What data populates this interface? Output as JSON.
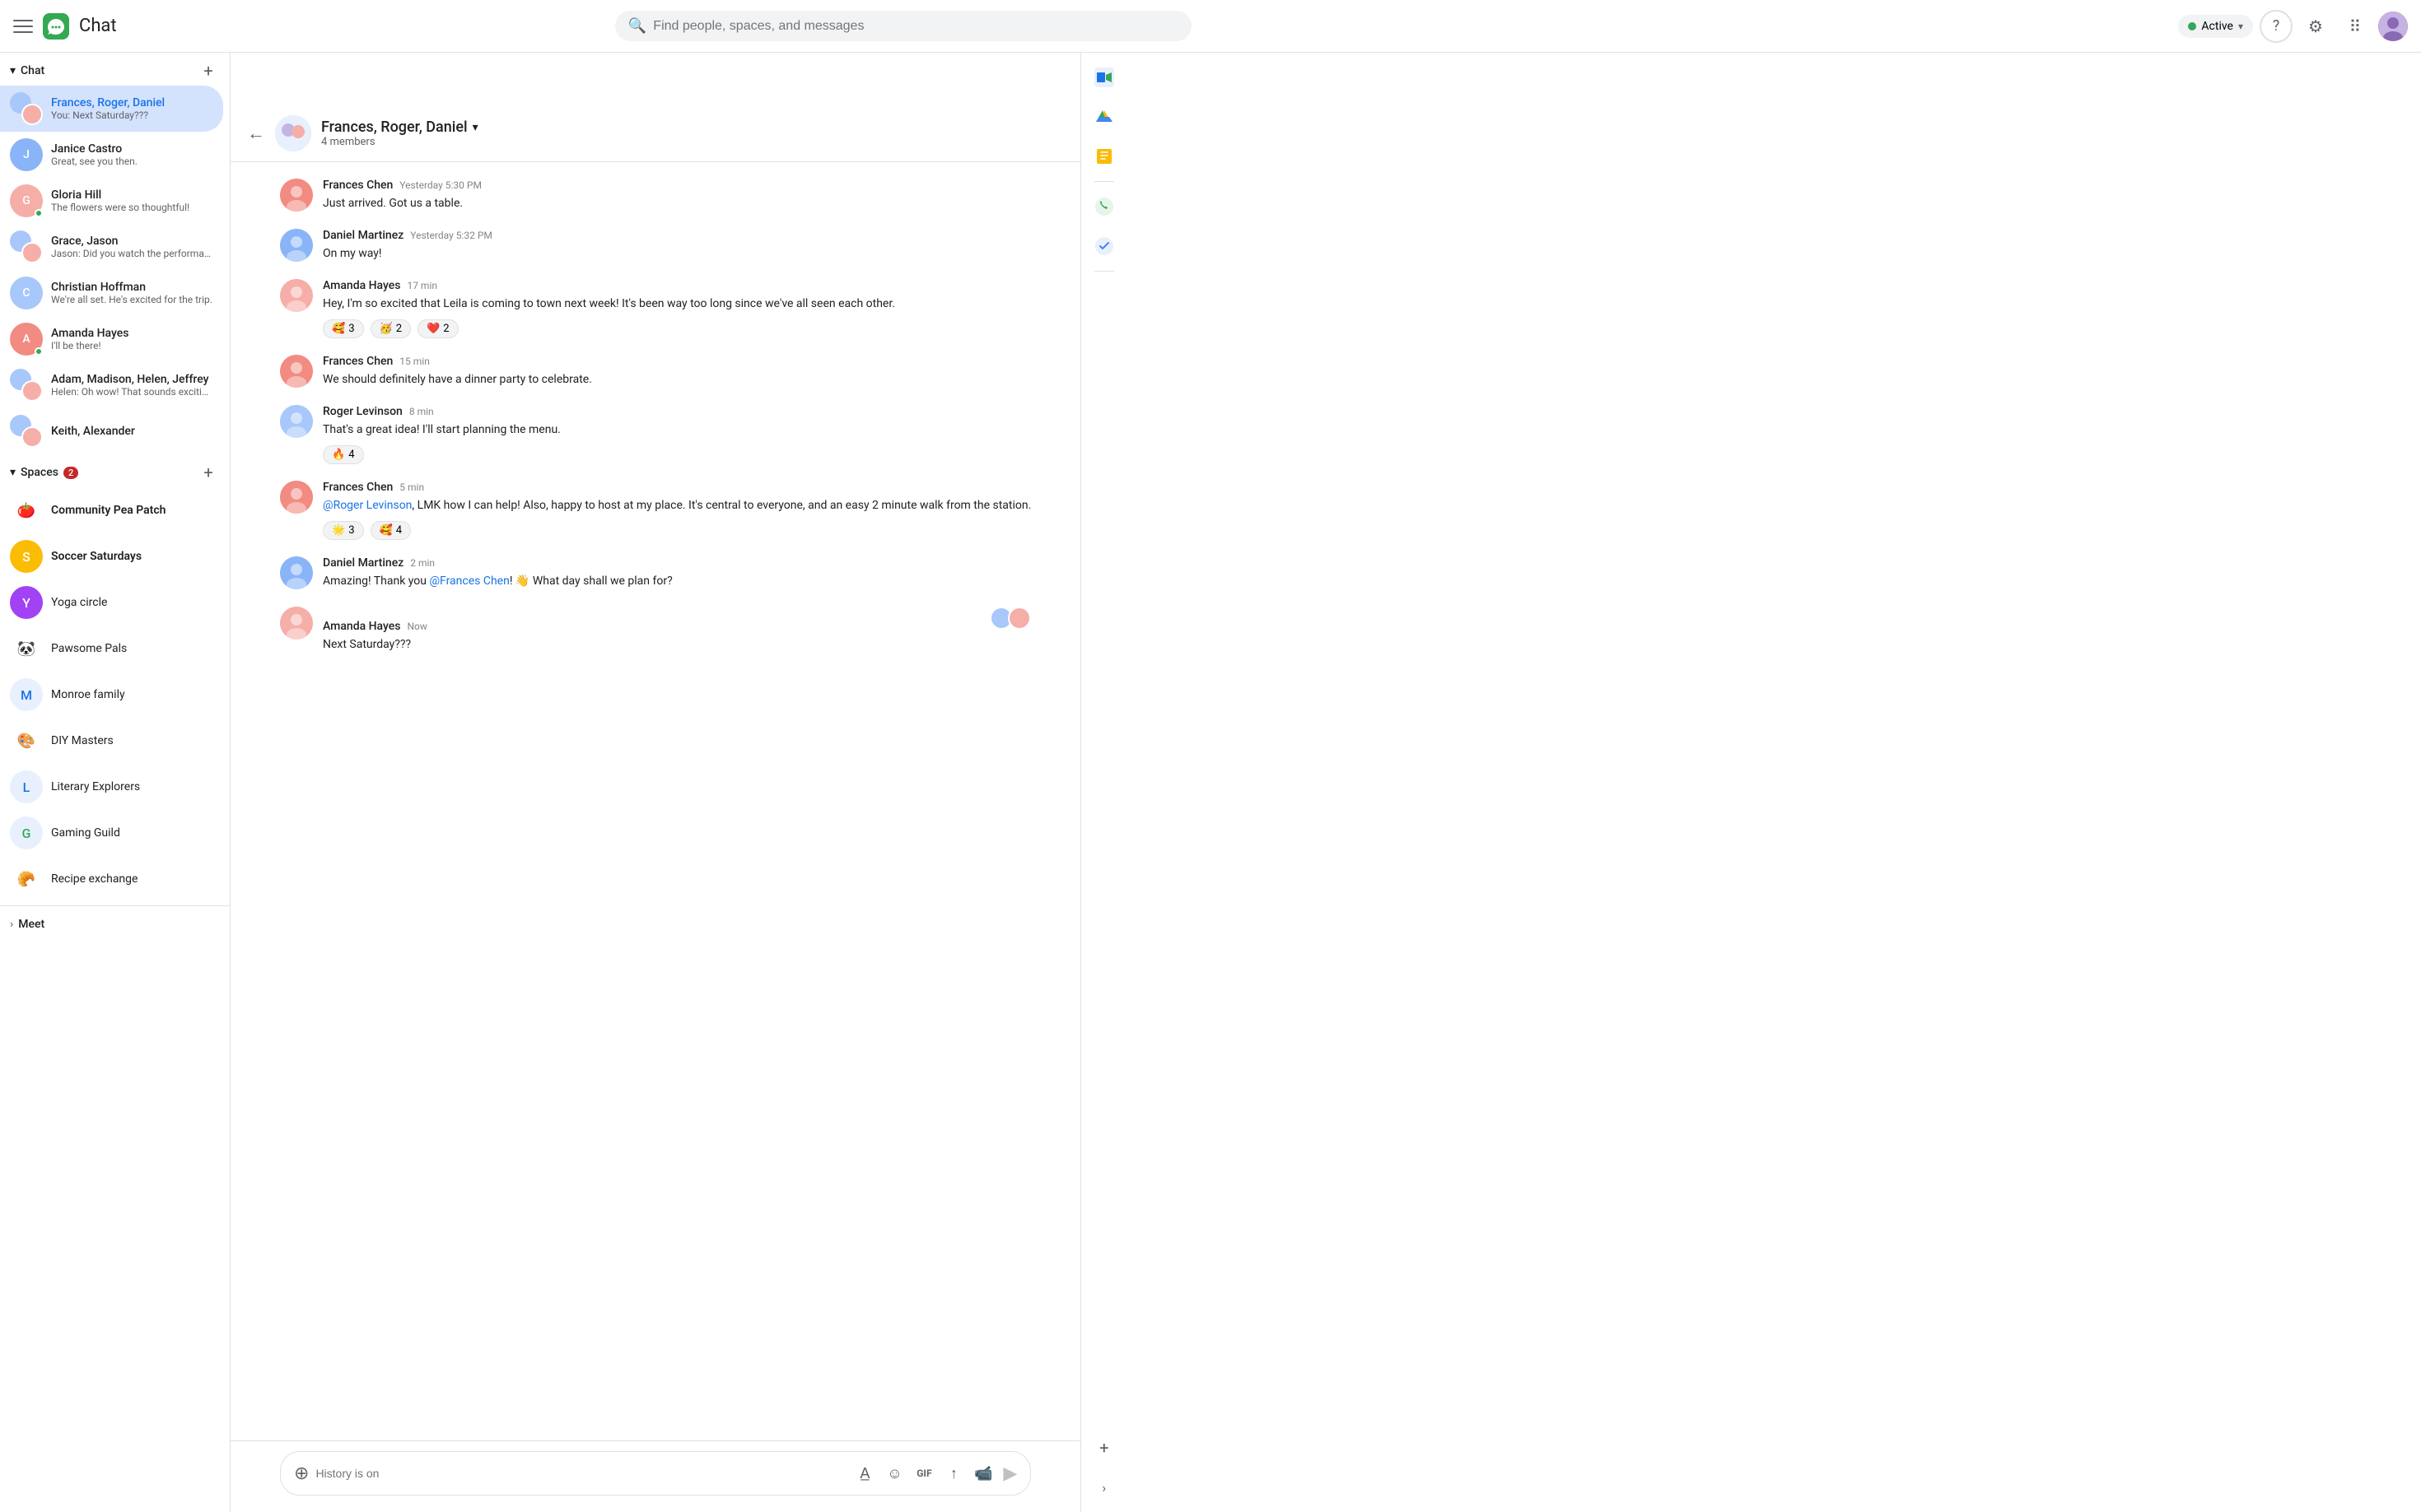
{
  "app": {
    "title": "Chat",
    "logo_color": "#34a853"
  },
  "topbar": {
    "search_placeholder": "Find people, spaces, and messages",
    "active_label": "Active",
    "active_color": "#34a853"
  },
  "sidebar": {
    "chat_section": "Chat",
    "spaces_section": "Spaces",
    "spaces_badge": "2",
    "meet_section": "Meet",
    "add_label": "+",
    "chats": [
      {
        "id": "frances-roger-daniel",
        "name": "Frances, Roger, Daniel",
        "preview": "You: Next Saturday???",
        "active": true,
        "avatar_type": "group"
      },
      {
        "id": "janice-castro",
        "name": "Janice Castro",
        "preview": "Great, see you then.",
        "active": false,
        "avatar_type": "single",
        "color": "#8ab4f8"
      },
      {
        "id": "gloria-hill",
        "name": "Gloria Hill",
        "preview": "The flowers were so thoughtful!",
        "active": false,
        "avatar_type": "single",
        "color": "#f6aea9",
        "online": true
      },
      {
        "id": "grace-jason",
        "name": "Grace, Jason",
        "preview": "Jason: Did you watch the performan ...",
        "active": false,
        "avatar_type": "group"
      },
      {
        "id": "christian-hoffman",
        "name": "Christian Hoffman",
        "preview": "We're all set.  He's excited for the trip.",
        "active": false,
        "avatar_type": "single",
        "color": "#a8c7fa"
      },
      {
        "id": "amanda-hayes",
        "name": "Amanda Hayes",
        "preview": "I'll be there!",
        "active": false,
        "avatar_type": "single",
        "color": "#f28b82",
        "online": true
      },
      {
        "id": "adam-madison-helen-jeffrey",
        "name": "Adam, Madison, Helen, Jeffrey",
        "preview": "Helen: Oh wow! That sounds exciting ...",
        "active": false,
        "avatar_type": "group"
      },
      {
        "id": "keith-alexander",
        "name": "Keith, Alexander",
        "preview": "",
        "active": false,
        "avatar_type": "group"
      }
    ],
    "spaces": [
      {
        "id": "community-pea-patch",
        "name": "Community Pea Patch",
        "icon": "🍅",
        "bold": true
      },
      {
        "id": "soccer-saturdays",
        "name": "Soccer Saturdays",
        "icon": "S",
        "bold": true,
        "icon_bg": "#fbbc04",
        "icon_color": "#fff"
      },
      {
        "id": "yoga-circle",
        "name": "Yoga circle",
        "icon": "Y",
        "bold": false,
        "icon_bg": "#a142f4",
        "icon_color": "#fff"
      },
      {
        "id": "pawsome-pals",
        "name": "Pawsome Pals",
        "icon": "🐼",
        "bold": false
      },
      {
        "id": "monroe-family",
        "name": "Monroe family",
        "icon": "M",
        "bold": false,
        "icon_bg": "#e8f0fe",
        "icon_color": "#1a73e8"
      },
      {
        "id": "diy-masters",
        "name": "DIY Masters",
        "icon": "🎨",
        "bold": false
      },
      {
        "id": "literary-explorers",
        "name": "Literary Explorers",
        "icon": "L",
        "bold": false,
        "icon_bg": "#e8f0fe",
        "icon_color": "#1a73e8"
      },
      {
        "id": "gaming-guild",
        "name": "Gaming Guild",
        "icon": "G",
        "bold": false,
        "icon_bg": "#e8f0fe",
        "icon_color": "#34a853"
      },
      {
        "id": "recipe-exchange",
        "name": "Recipe exchange",
        "icon": "🥐",
        "bold": false
      }
    ]
  },
  "chat_view": {
    "title": "Frances, Roger, Daniel",
    "members_count": "4 members",
    "messages": [
      {
        "id": "msg1",
        "sender": "Frances Chen",
        "time": "Yesterday 5:30 PM",
        "text": "Just arrived.  Got us a table.",
        "avatar_color": "#f28b82",
        "reactions": []
      },
      {
        "id": "msg2",
        "sender": "Daniel Martinez",
        "time": "Yesterday 5:32 PM",
        "text": "On my way!",
        "avatar_color": "#8ab4f8",
        "reactions": []
      },
      {
        "id": "msg3",
        "sender": "Amanda Hayes",
        "time": "17 min",
        "text": "Hey, I'm so excited that Leila is coming to town next week! It's been way too long since we've all seen each other.",
        "avatar_color": "#f6aea9",
        "reactions": [
          {
            "emoji": "🥰",
            "count": "3"
          },
          {
            "emoji": "🥳",
            "count": "2"
          },
          {
            "emoji": "❤️",
            "count": "2"
          }
        ]
      },
      {
        "id": "msg4",
        "sender": "Frances Chen",
        "time": "15 min",
        "text": "We should definitely have a dinner party to celebrate.",
        "avatar_color": "#f28b82",
        "reactions": []
      },
      {
        "id": "msg5",
        "sender": "Roger Levinson",
        "time": "8 min",
        "text": "That's a great idea! I'll start planning the menu.",
        "avatar_color": "#a8c7fa",
        "reactions": [
          {
            "emoji": "🔥",
            "count": "4"
          }
        ]
      },
      {
        "id": "msg6",
        "sender": "Frances Chen",
        "time": "5 min",
        "text_parts": [
          {
            "type": "mention",
            "text": "@Roger Levinson"
          },
          {
            "type": "plain",
            "text": ", LMK how I can help!  Also, happy to host at my place. It's central to everyone, and an easy 2 minute walk from the station."
          }
        ],
        "avatar_color": "#f28b82",
        "reactions": [
          {
            "emoji": "🌟",
            "count": "3"
          },
          {
            "emoji": "🥰",
            "count": "4"
          }
        ]
      },
      {
        "id": "msg7",
        "sender": "Daniel Martinez",
        "time": "2 min",
        "text_parts": [
          {
            "type": "plain",
            "text": "Amazing! Thank you "
          },
          {
            "type": "mention",
            "text": "@Frances Chen"
          },
          {
            "type": "plain",
            "text": "! 👋 What day shall we plan for?"
          }
        ],
        "avatar_color": "#8ab4f8",
        "reactions": []
      },
      {
        "id": "msg8",
        "sender": "Amanda Hayes",
        "time": "Now",
        "text": "Next Saturday???",
        "avatar_color": "#f6aea9",
        "reactions": [],
        "show_member_avatars": true
      }
    ],
    "input_placeholder": "History is on"
  },
  "right_sidebar": {
    "icons": [
      {
        "id": "google-meet",
        "symbol": "📅",
        "color": "#1a73e8"
      },
      {
        "id": "google-drive",
        "symbol": "△",
        "color": "#34a853"
      },
      {
        "id": "google-keep",
        "symbol": "■",
        "color": "#fbbc04"
      },
      {
        "id": "google-phone",
        "symbol": "📞",
        "color": "#34a853"
      },
      {
        "id": "google-tasks",
        "symbol": "✔",
        "color": "#4285f4"
      }
    ],
    "add_label": "+"
  }
}
